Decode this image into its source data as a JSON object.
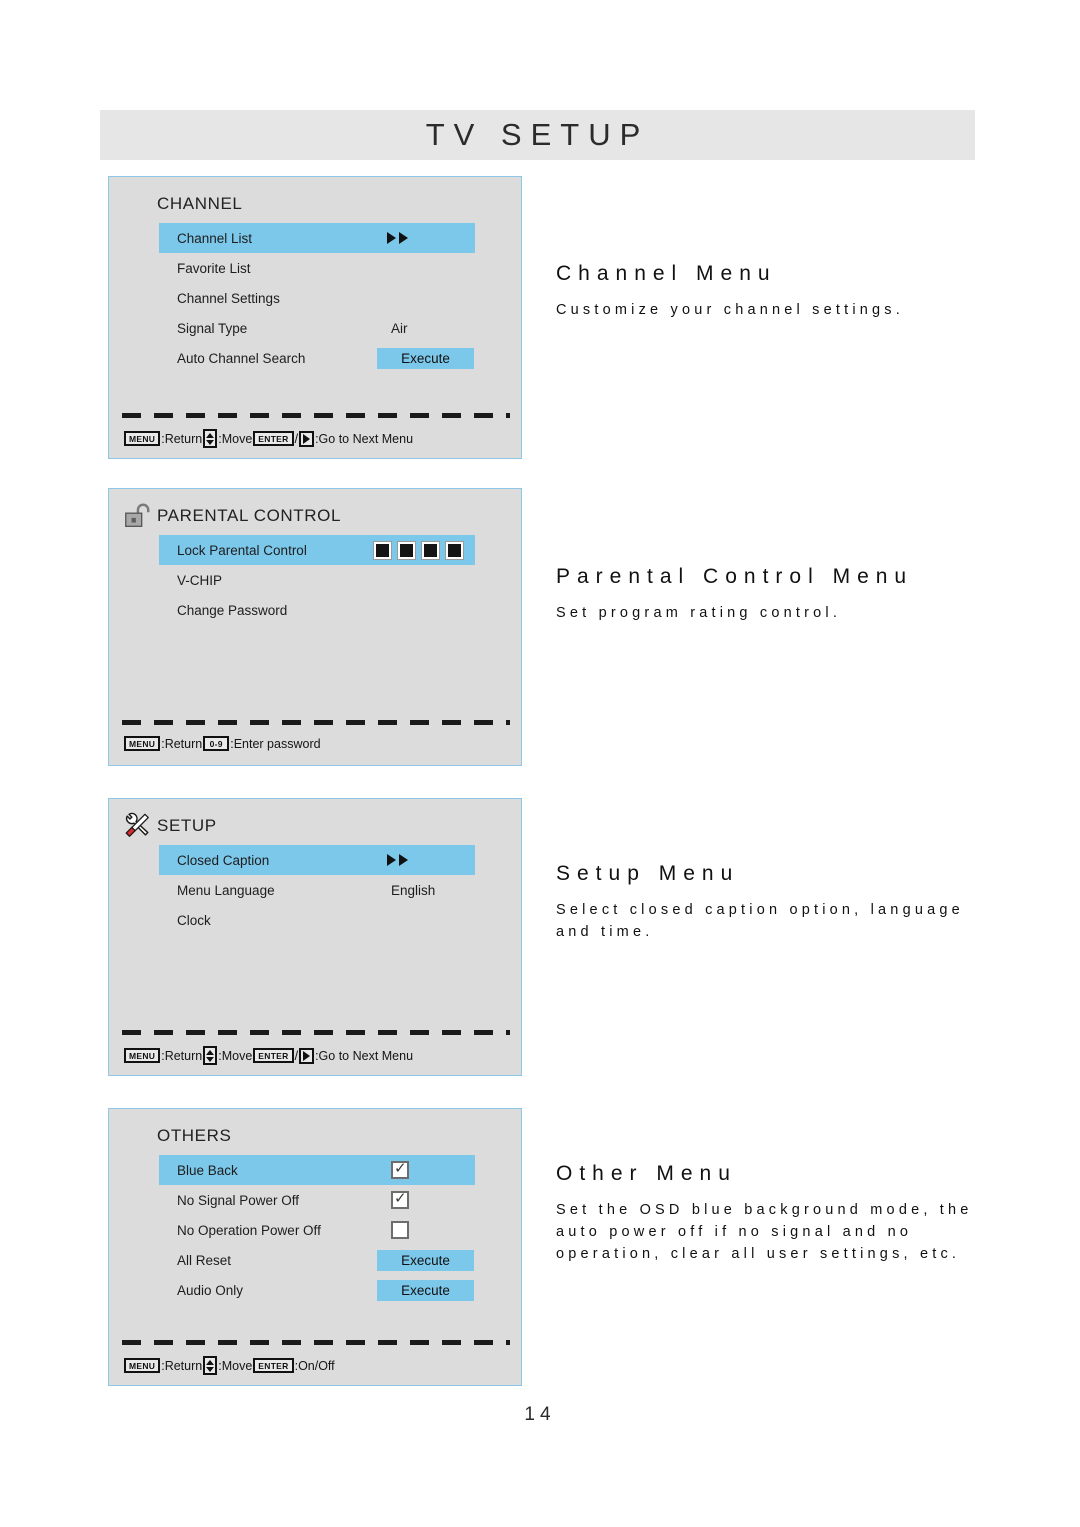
{
  "document": {
    "title": "TV SETUP",
    "page_number": "14"
  },
  "colors": {
    "highlight": "#7cc8ea",
    "panel_background": "#dcdcdc",
    "panel_border": "#8fc7e8",
    "header_background": "#e6e6e6"
  },
  "panels": [
    {
      "id": "channel",
      "icon": "none",
      "title": "CHANNEL",
      "rows": [
        {
          "label": "Channel List",
          "value": "",
          "control": "arrows",
          "selected": true
        },
        {
          "label": "Favorite List",
          "value": "",
          "control": "none",
          "selected": false
        },
        {
          "label": "Channel Settings",
          "value": "",
          "control": "none",
          "selected": false
        },
        {
          "label": "Signal Type",
          "value": "Air",
          "control": "text",
          "selected": false
        },
        {
          "label": "Auto Channel Search",
          "value": "Execute",
          "control": "execute",
          "selected": false
        }
      ],
      "hint": {
        "keys": [
          {
            "type": "key",
            "label": "MENU"
          },
          {
            "type": "text",
            "label": ":Return"
          },
          {
            "type": "updown",
            "label": "up-down-arrow-key"
          },
          {
            "type": "text",
            "label": ":Move"
          },
          {
            "type": "key",
            "label": "ENTER"
          },
          {
            "type": "text",
            "label": "/"
          },
          {
            "type": "right",
            "label": "right-arrow-key"
          },
          {
            "type": "text",
            "label": ":Go to Next Menu"
          }
        ]
      }
    },
    {
      "id": "parental",
      "icon": "open-padlock",
      "title": "PARENTAL CONTROL",
      "rows": [
        {
          "label": "Lock Parental Control",
          "value": "",
          "control": "password",
          "selected": true
        },
        {
          "label": "V-CHIP",
          "value": "",
          "control": "none",
          "selected": false
        },
        {
          "label": "Change Password",
          "value": "",
          "control": "none",
          "selected": false
        }
      ],
      "hint": {
        "keys": [
          {
            "type": "key",
            "label": "MENU"
          },
          {
            "type": "text",
            "label": ":Return"
          },
          {
            "type": "key",
            "label": "0-9"
          },
          {
            "type": "text",
            "label": ":Enter password"
          }
        ]
      }
    },
    {
      "id": "setup",
      "icon": "wrench-screwdriver",
      "title": "SETUP",
      "rows": [
        {
          "label": "Closed Caption",
          "value": "",
          "control": "arrows",
          "selected": true
        },
        {
          "label": "Menu Language",
          "value": "English",
          "control": "text",
          "selected": false
        },
        {
          "label": "Clock",
          "value": "",
          "control": "none",
          "selected": false
        }
      ],
      "hint": {
        "keys": [
          {
            "type": "key",
            "label": "MENU"
          },
          {
            "type": "text",
            "label": ":Return"
          },
          {
            "type": "updown",
            "label": "up-down-arrow-key"
          },
          {
            "type": "text",
            "label": ":Move"
          },
          {
            "type": "key",
            "label": "ENTER"
          },
          {
            "type": "text",
            "label": "/"
          },
          {
            "type": "right",
            "label": "right-arrow-key"
          },
          {
            "type": "text",
            "label": ":Go to Next Menu"
          }
        ]
      }
    },
    {
      "id": "others",
      "icon": "none",
      "title": "OTHERS",
      "rows": [
        {
          "label": "Blue Back",
          "value": "",
          "control": "checkbox-checked",
          "selected": true
        },
        {
          "label": "No Signal Power Off",
          "value": "",
          "control": "checkbox-checked",
          "selected": false
        },
        {
          "label": "No Operation Power Off",
          "value": "",
          "control": "checkbox-unchecked",
          "selected": false
        },
        {
          "label": "All Reset",
          "value": "Execute",
          "control": "execute",
          "selected": false
        },
        {
          "label": "Audio Only",
          "value": "Execute",
          "control": "execute",
          "selected": false
        }
      ],
      "hint": {
        "keys": [
          {
            "type": "key",
            "label": "MENU"
          },
          {
            "type": "text",
            "label": ":Return"
          },
          {
            "type": "updown",
            "label": "up-down-arrow-key"
          },
          {
            "type": "text",
            "label": ":Move"
          },
          {
            "type": "key",
            "label": "ENTER"
          },
          {
            "type": "text",
            "label": ":On/Off"
          }
        ]
      }
    }
  ],
  "descriptions": [
    {
      "id": "channel",
      "heading": "Channel Menu",
      "body": "Customize your channel settings."
    },
    {
      "id": "parental",
      "heading": "Parental Control Menu",
      "body": "Set program rating control."
    },
    {
      "id": "setup",
      "heading": "Setup Menu",
      "body": "Select closed caption option, language and time."
    },
    {
      "id": "others",
      "heading": "Other Menu",
      "body": "Set the OSD blue background mode, the auto power off if no signal and no operation, clear all user settings, etc."
    }
  ]
}
